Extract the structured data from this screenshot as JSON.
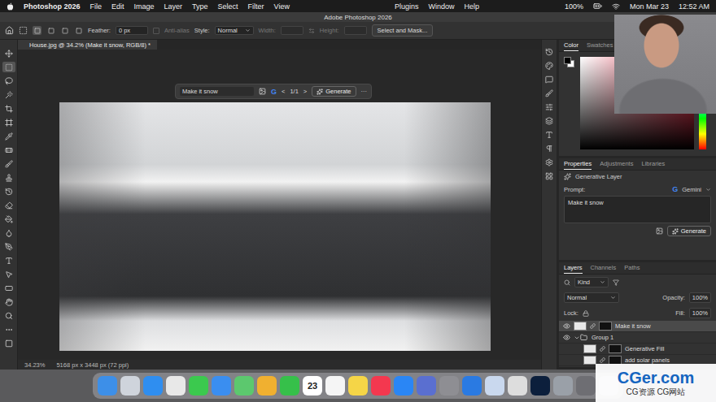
{
  "menubar": {
    "app": "Photoshop 2026",
    "items": [
      "File",
      "Edit",
      "Image",
      "Layer",
      "Type",
      "Select",
      "Filter",
      "View"
    ],
    "right_items": [
      "Plugins",
      "Window",
      "Help"
    ],
    "battery": "100%",
    "date": "Mon Mar 23",
    "time": "12:52 AM"
  },
  "window": {
    "title": "Adobe Photoshop 2026"
  },
  "options_bar": {
    "feather_label": "Feather:",
    "feather_value": "0 px",
    "anti_alias": "Anti-alias",
    "anti_alias_disabled": true,
    "style_label": "Style:",
    "style_value": "Normal",
    "width_label": "Width:",
    "height_label": "Height:",
    "size_disabled": true,
    "select_mask": "Select and Mask..."
  },
  "selection_modes": [
    {
      "selected": true
    },
    {
      "selected": false
    },
    {
      "selected": false
    },
    {
      "selected": false
    }
  ],
  "document_tab": {
    "title": "House.jpg @ 34.2% (Make it snow, RGB/8) *",
    "selected": true
  },
  "tools": [
    {
      "selected": false
    },
    {
      "selected": true
    },
    {
      "selected": false
    },
    {
      "selected": false
    },
    {
      "selected": false
    },
    {
      "selected": false
    },
    {
      "selected": false
    },
    {
      "selected": false
    },
    {
      "selected": false
    },
    {
      "selected": false
    },
    {
      "selected": false
    },
    {
      "selected": false
    },
    {
      "selected": false
    },
    {
      "selected": false
    },
    {
      "selected": false
    },
    {
      "selected": false
    },
    {
      "selected": false
    },
    {
      "selected": false
    },
    {
      "selected": false
    },
    {
      "selected": false
    },
    {
      "selected": false
    },
    {
      "selected": false
    }
  ],
  "taskbar": {
    "prompt": "Make it snow",
    "model": "G",
    "prev": "<",
    "page": "1/1",
    "next": ">",
    "generate": "Generate",
    "more": "···"
  },
  "status": {
    "zoom": "34.23%",
    "size": "5168 px x 3448 px (72 ppi)"
  },
  "color_panel": {
    "tabs": [
      {
        "label": "Color",
        "selected": true
      },
      {
        "label": "Swatches",
        "selected": false
      }
    ]
  },
  "properties": {
    "tabs": [
      {
        "label": "Properties",
        "selected": true
      },
      {
        "label": "Adjustments",
        "selected": false
      },
      {
        "label": "Libraries",
        "selected": false
      }
    ],
    "layer_type": "Generative Layer",
    "prompt_label": "Prompt:",
    "model_logo": "G",
    "model": "Gemini",
    "prompt": "Make it snow",
    "generate": "Generate"
  },
  "layers": {
    "tabs": [
      {
        "label": "Layers",
        "selected": true
      },
      {
        "label": "Channels",
        "selected": false
      },
      {
        "label": "Paths",
        "selected": false
      }
    ],
    "filter": "Kind",
    "blend": "Normal",
    "opacity_label": "Opacity:",
    "opacity": "100%",
    "lock_label": "Lock:",
    "fill_label": "Fill:",
    "fill": "100%",
    "rows": [
      {
        "name": "Make it snow",
        "kind": "layer",
        "selected": true,
        "visible": true,
        "expanded": false
      },
      {
        "name": "Group 1",
        "kind": "group",
        "selected": false,
        "visible": true,
        "expanded": true
      },
      {
        "name": "Generative Fill",
        "kind": "child",
        "selected": false,
        "visible": false,
        "expanded": false
      },
      {
        "name": "add solar panels",
        "kind": "child",
        "selected": false,
        "visible": false,
        "expanded": false
      }
    ]
  },
  "dock": {
    "apps": [
      {
        "kind": "app",
        "color": "#3d8fe8"
      },
      {
        "kind": "app",
        "color": "#cfd4dc"
      },
      {
        "kind": "app",
        "color": "#2f8ef0"
      },
      {
        "kind": "app",
        "color": "#e8e8e8"
      },
      {
        "kind": "app",
        "color": "#3bc94e"
      },
      {
        "kind": "app",
        "color": "#3a8ef0"
      },
      {
        "kind": "app",
        "color": "#5cc86e"
      },
      {
        "kind": "app",
        "color": "#f0b030"
      },
      {
        "kind": "app",
        "color": "#36c04a"
      },
      {
        "kind": "calendar",
        "color": "#ffffff",
        "day": "23"
      },
      {
        "kind": "app",
        "color": "#f5f5f5"
      },
      {
        "kind": "app",
        "color": "#f5d547"
      },
      {
        "kind": "app",
        "color": "#f4384f"
      },
      {
        "kind": "app",
        "color": "#2a86f5"
      },
      {
        "kind": "app",
        "color": "#5a6fd0"
      },
      {
        "kind": "app",
        "color": "#8e8e93"
      },
      {
        "kind": "app",
        "color": "#2a7ae2"
      },
      {
        "kind": "app",
        "color": "#c9d8ee"
      },
      {
        "kind": "app",
        "color": "#dddddd"
      },
      {
        "kind": "app",
        "color": "#0c1f3c"
      },
      {
        "kind": "app",
        "color": "#9aa0a8"
      },
      {
        "kind": "app",
        "color": "#6e6e73"
      },
      {
        "kind": "app",
        "color": "#b0b4ba"
      }
    ]
  },
  "watermark": {
    "title": "CGer.com",
    "subtitle": "CG资源 CG网站"
  }
}
